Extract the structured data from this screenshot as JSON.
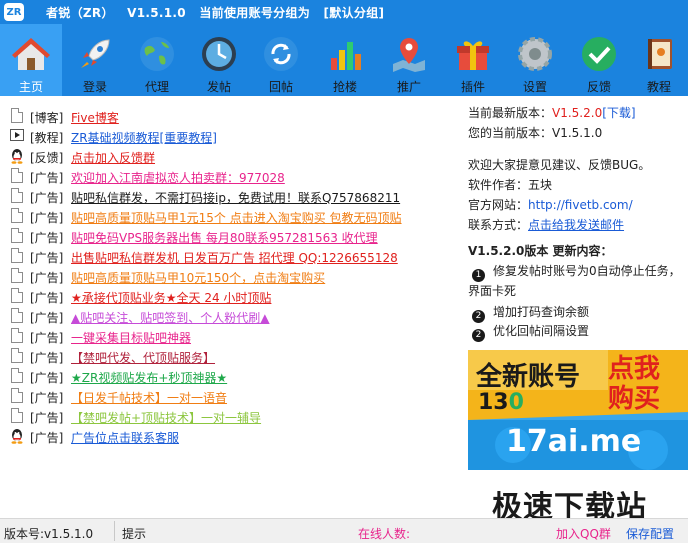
{
  "window": {
    "logo_text": "ZR",
    "title": "者锐（ZR）   V1.5.1.0   当前使用账号分组为   [默认分组]"
  },
  "toolbar": {
    "items": [
      {
        "label": "主页",
        "icon": "home-icon"
      },
      {
        "label": "登录",
        "icon": "rocket-icon"
      },
      {
        "label": "代理",
        "icon": "globe-icon"
      },
      {
        "label": "发帖",
        "icon": "clock-icon"
      },
      {
        "label": "回帖",
        "icon": "refresh-icon"
      },
      {
        "label": "抢楼",
        "icon": "bar-chart-icon"
      },
      {
        "label": "推广",
        "icon": "map-pin-icon"
      },
      {
        "label": "插件",
        "icon": "gift-icon"
      },
      {
        "label": "设置",
        "icon": "gear-icon"
      },
      {
        "label": "反馈",
        "icon": "check-circle-icon"
      },
      {
        "label": "教程",
        "icon": "book-icon"
      }
    ]
  },
  "list": {
    "items": [
      {
        "tag": "[博客]",
        "text": "Five博客",
        "color": "#e0211e",
        "icon": "doc"
      },
      {
        "tag": "[教程]",
        "text": "ZR基础视频教程[重要教程]",
        "color": "#1a5bd6",
        "icon": "video"
      },
      {
        "tag": "[反馈]",
        "text": "点击加入反馈群",
        "color": "#e0211e",
        "icon": "qq"
      },
      {
        "tag": "[广告]",
        "text": "欢迎加入江南虐拟恋人拍卖群：977028",
        "color": "#e8248c",
        "icon": "doc"
      },
      {
        "tag": "[广告]",
        "text": "贴吧私信群发，不需打码接ip，免费试用！联系Q757868211",
        "color": "#1a1a1a",
        "icon": "doc"
      },
      {
        "tag": "[广告]",
        "text": "贴吧高质量顶贴马甲1元15个 点击进入淘宝购买 包教无码顶贴",
        "color": "#f07d13",
        "icon": "doc"
      },
      {
        "tag": "[广告]",
        "text": "贴吧免码VPS服务器出售 每月80联系957281563 收代理",
        "color": "#e8248c",
        "icon": "doc"
      },
      {
        "tag": "[广告]",
        "text": "出售贴吧私信群发机 日发百万广告 招代理 QQ:1226655128",
        "color": "#e0211e",
        "icon": "doc"
      },
      {
        "tag": "[广告]",
        "text": "贴吧高质量顶贴马甲10元150个，点击淘宝购买",
        "color": "#f07d13",
        "icon": "doc"
      },
      {
        "tag": "[广告]",
        "text": "★承接代顶贴业务★全天 24 小时顶贴",
        "color": "#e0211e",
        "icon": "doc"
      },
      {
        "tag": "[广告]",
        "text": "▲贴吧关注、贴吧签到、个人粉代刷▲",
        "color": "#c64bd8",
        "icon": "doc"
      },
      {
        "tag": "[广告]",
        "text": "一键采集目标贴吧神器",
        "color": "#e8248c",
        "icon": "doc"
      },
      {
        "tag": "[广告]",
        "text": "【禁吧代发、代顶贴服务】",
        "color": "#b0213b",
        "icon": "doc"
      },
      {
        "tag": "[广告]",
        "text": "★ZR视频贴发布+秒顶神器★",
        "color": "#1ea84a",
        "icon": "doc"
      },
      {
        "tag": "[广告]",
        "text": "【日发千帖技术】一对一语音",
        "color": "#f07d13",
        "icon": "doc"
      },
      {
        "tag": "[广告]",
        "text": "【禁吧发帖+顶贴技术】一对一辅导",
        "color": "#8cc63e",
        "icon": "doc"
      },
      {
        "tag": "[广告]",
        "text": "广告位点击联系客服",
        "color": "#1a5bd6",
        "icon": "qq"
      }
    ]
  },
  "info": {
    "latest_label": "当前最新版本：",
    "latest_version": "V1.5.2.0",
    "download_link": "[下载]",
    "current_label": "您的当前版本：",
    "current_version": "V1.5.1.0",
    "welcome": "欢迎大家提意见建议、反馈BUG。",
    "author_label": "软件作者：",
    "author": "五块",
    "site_label": "官方网站：",
    "site": "http://fivetb.com/",
    "contact_label": "联系方式：",
    "contact": "点击给我发送邮件",
    "changelog_title": "V1.5.2.0版本  更新内容：",
    "changes": [
      {
        "num": "1",
        "text": "修复发帖时账号为0自动停止任务，"
      },
      {
        "num": "",
        "text": "界面卡死"
      },
      {
        "num": "2",
        "text": "增加打码查询余额"
      },
      {
        "num": "2",
        "text": "优化回帖间隔设置"
      }
    ]
  },
  "ad": {
    "line1": "全新账号",
    "line2": "13",
    "line3": "0",
    "cta1": "点我",
    "cta2": "购买",
    "domain": "17ai.me"
  },
  "watermark": "极速下载站",
  "status": {
    "version": "版本号:v1.5.1.0",
    "hint": "提示",
    "online": "在线人数:",
    "qq_group": "加入QQ群",
    "save": "保存配置"
  },
  "colors": {
    "titlebar": "#1b83de",
    "accent_red": "#e0211e",
    "link_blue": "#1a5bd6",
    "ad_bg": "#f4b41a"
  }
}
